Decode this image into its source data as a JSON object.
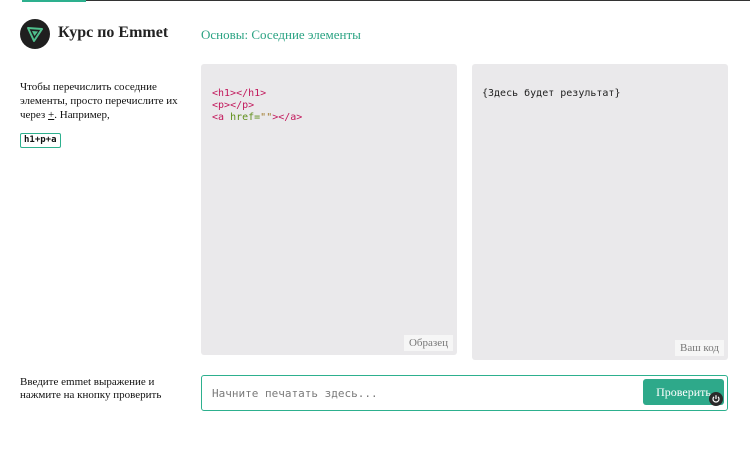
{
  "header": {
    "brand": "Курс по Emmet",
    "lesson": "Основы: Соседние элементы"
  },
  "instructions": {
    "text_before": "Чтобы перечислить соседние элементы, просто перечислите их через ",
    "plus": "+",
    "text_after": ". Например,",
    "example": "h1+p+a"
  },
  "sample": {
    "line1_open": "<h1>",
    "line1_close": "</h1>",
    "line2_open": "<p>",
    "line2_close": "</p>",
    "line3_tag_open": "<a ",
    "line3_attr": "href=",
    "line3_value": "\"\"",
    "line3_gt": ">",
    "line3_close": "</a>",
    "label": "Образец"
  },
  "yours": {
    "result_placeholder": "{Здесь будет результат}",
    "label": "Ваш код"
  },
  "input": {
    "prompt": "Введите emmet выражение и нажмите на кнопку проверить",
    "placeholder": "Начните печатать здесь...",
    "value": "",
    "button": "Проверить"
  },
  "colors": {
    "accent": "#2db08e",
    "panel": "#eae9eb",
    "tag": "#c2185b",
    "attr": "#5f8f1a"
  },
  "icons": {
    "logo": "emmet-logo-icon",
    "power": "power-icon"
  }
}
